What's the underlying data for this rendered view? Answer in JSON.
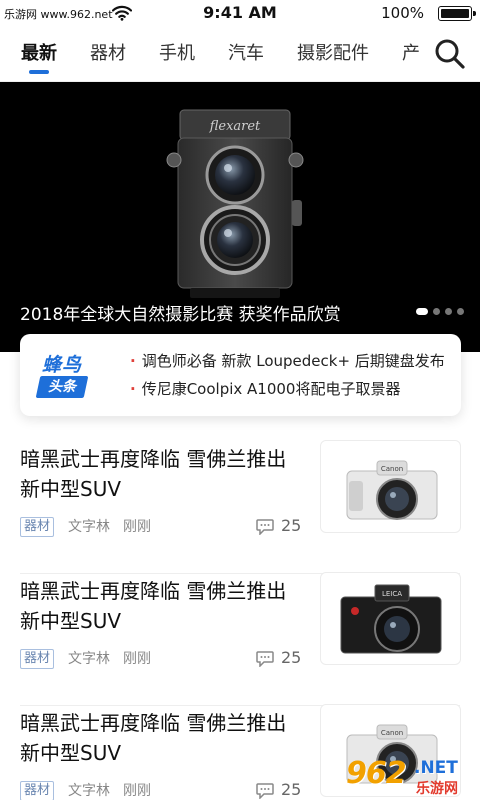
{
  "status_bar": {
    "carrier": "乐游网 www.962.net",
    "time": "9:41 AM",
    "battery": "100%",
    "battery_level": 1.0
  },
  "tabs": [
    {
      "label": "最新",
      "active": true
    },
    {
      "label": "器材",
      "active": false
    },
    {
      "label": "手机",
      "active": false
    },
    {
      "label": "汽车",
      "active": false
    },
    {
      "label": "摄影配件",
      "active": false
    },
    {
      "label": "产品",
      "active": false
    }
  ],
  "banner": {
    "caption": "2018年全球大自然摄影比赛 获奖作品欣赏",
    "camera_brand": "flexaret",
    "slide_count": 4,
    "active_slide": 1
  },
  "headlines": {
    "logo_top": "蜂鸟",
    "logo_bottom": "头条",
    "items": [
      "调色师必备 新款 Loupedeck+ 后期键盘发布",
      "传尼康Coolpix A1000将配电子取景器"
    ]
  },
  "articles": [
    {
      "title": "暗黑武士再度降临 雪佛兰推出新中型SUV",
      "tag": "器材",
      "author": "文字林",
      "time": "刚刚",
      "comments": "25",
      "camera_label": "Canon",
      "camera_color": "#e8e8e8"
    },
    {
      "title": "暗黑武士再度降临 雪佛兰推出新中型SUV",
      "tag": "器材",
      "author": "文字林",
      "time": "刚刚",
      "comments": "25",
      "camera_label": "LEICA",
      "camera_color": "#1c1c1c"
    },
    {
      "title": "暗黑武士再度降临 雪佛兰推出新中型SUV",
      "tag": "器材",
      "author": "文字林",
      "time": "刚刚",
      "comments": "25",
      "camera_label": "Canon",
      "camera_color": "#e8e8e8"
    }
  ],
  "watermark": {
    "number": "962",
    "domain": ".NET",
    "chinese": "乐游网"
  },
  "colors": {
    "accent": "#1e6fd9",
    "bullet": "#e0413b",
    "tag": "#6a86b0"
  }
}
